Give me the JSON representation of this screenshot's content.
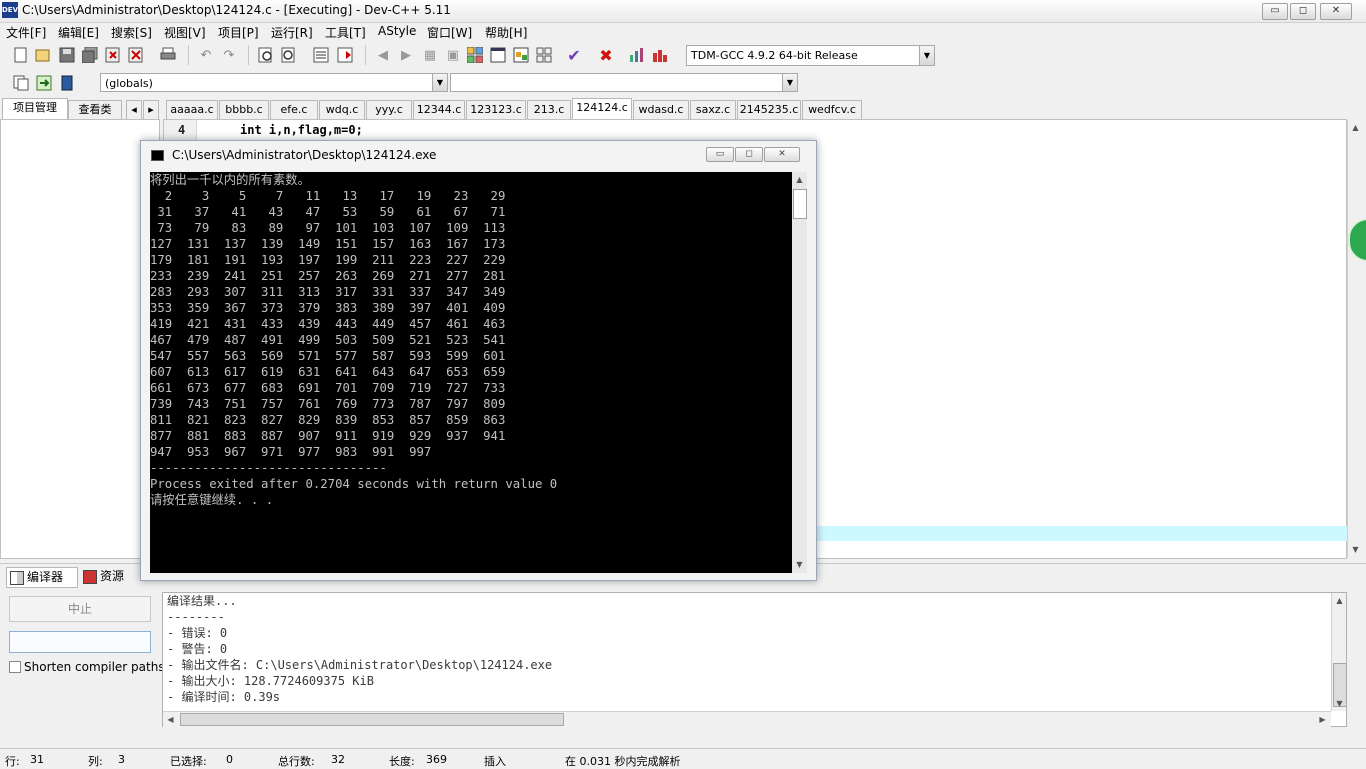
{
  "window": {
    "title": "C:\\Users\\Administrator\\Desktop\\124124.c - [Executing] - Dev-C++ 5.11",
    "icon_text": "DEV",
    "min_glyph": "▭",
    "max_glyph": "◻",
    "close_glyph": "✕"
  },
  "menu": [
    "文件[F]",
    "编辑[E]",
    "搜索[S]",
    "视图[V]",
    "项目[P]",
    "运行[R]",
    "工具[T]",
    "AStyle",
    "窗口[W]",
    "帮助[H]"
  ],
  "toolbar": {
    "compiler_select": "TDM-GCC 4.9.2 64-bit Release",
    "globals_select": "(globals)",
    "second_select": ""
  },
  "left_tabs": [
    "项目管理",
    "查看类"
  ],
  "file_tabs": [
    "aaaaa.c",
    "bbbb.c",
    "efe.c",
    "wdq.c",
    "yyy.c",
    "12344.c",
    "123123.c",
    "213.c",
    "124124.c",
    "wdasd.c",
    "saxz.c",
    "2145235.c",
    "wedfcv.c"
  ],
  "active_tab": "124124.c",
  "editor": {
    "line_number": "4",
    "code_line": "int i,n,flag,m=0;"
  },
  "console": {
    "title": "C:\\Users\\Administrator\\Desktop\\124124.exe",
    "output": "将列出一千以内的所有素数。\n  2    3    5    7   11   13   17   19   23   29\n 31   37   41   43   47   53   59   61   67   71\n 73   79   83   89   97  101  103  107  109  113\n127  131  137  139  149  151  157  163  167  173\n179  181  191  193  197  199  211  223  227  229\n233  239  241  251  257  263  269  271  277  281\n283  293  307  311  313  317  331  337  347  349\n353  359  367  373  379  383  389  397  401  409\n419  421  431  433  439  443  449  457  461  463\n467  479  487  491  499  503  509  521  523  541\n547  557  563  569  571  577  587  593  599  601\n607  613  617  619  631  641  643  647  653  659\n661  673  677  683  691  701  709  719  727  733\n739  743  751  757  761  769  773  787  797  809\n811  821  823  827  829  839  853  857  859  863\n877  881  883  887  907  911  919  929  937  941\n947  953  967  971  977  983  991  997\n--------------------------------\nProcess exited after 0.2704 seconds with return value 0\n请按任意键继续. . ."
  },
  "bottom_tabs": [
    "编译器",
    "资源"
  ],
  "bottom_panel": {
    "stop_button": "中止",
    "shorten_label": "Shorten compiler paths",
    "output": "编译结果...\n--------\n- 错误: 0\n- 警告: 0\n- 输出文件名: C:\\Users\\Administrator\\Desktop\\124124.exe\n- 输出大小: 128.7724609375 KiB\n- 编译时间: 0.39s"
  },
  "status": {
    "row_label": "行:",
    "row_value": "31",
    "col_label": "列:",
    "col_value": "3",
    "sel_label": "已选择:",
    "sel_value": "0",
    "total_label": "总行数:",
    "total_value": "32",
    "len_label": "长度:",
    "len_value": "369",
    "insert": "插入",
    "parse": "在 0.031 秒内完成解析"
  },
  "colors": {
    "console_bg": "#000000",
    "console_fg": "#c0c0c0",
    "highlight_line": "#ccf8ff"
  }
}
